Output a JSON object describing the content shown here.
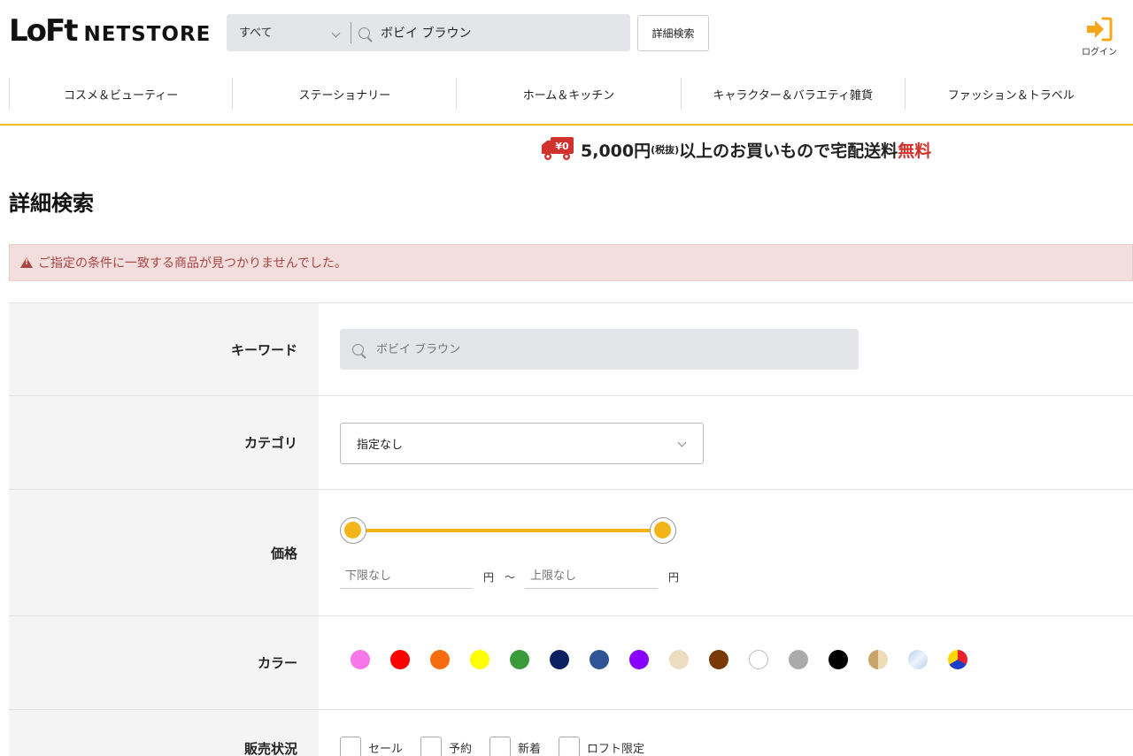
{
  "header": {
    "logo_mark": "LoFt",
    "logo_text": "NETSTORE",
    "search": {
      "scope": "すべて",
      "query": "ボビイ ブラウン"
    },
    "advanced_search_label": "詳細検索",
    "login_label": "ログイン"
  },
  "nav": {
    "items": [
      "コスメ＆ビューティー",
      "ステーショナリー",
      "ホーム＆キッチン",
      "キャラクター＆バラエティ雑貨",
      "ファッション＆トラベル"
    ]
  },
  "shipping_banner": {
    "badge": "¥0",
    "main": "5,000円",
    "paren": "(税抜)",
    "rest": "以上のお買いもので宅配送料",
    "free": "無料"
  },
  "page": {
    "title": "詳細検索",
    "alert": "ご指定の条件に一致する商品が見つかりませんでした。"
  },
  "form": {
    "keyword": {
      "label": "キーワード",
      "placeholder": "ボビイ ブラウン"
    },
    "category": {
      "label": "カテゴリ",
      "value": "指定なし"
    },
    "price": {
      "label": "価格",
      "min_placeholder": "下限なし",
      "max_placeholder": "上限なし",
      "unit": "円",
      "separator": "～",
      "range_fraction": [
        0,
        1
      ]
    },
    "color": {
      "label": "カラー",
      "swatches": [
        {
          "name": "pink",
          "color": "#f776e8"
        },
        {
          "name": "red",
          "color": "#ff0000"
        },
        {
          "name": "orange",
          "color": "#f86c10"
        },
        {
          "name": "yellow",
          "color": "#ffff00"
        },
        {
          "name": "green",
          "color": "#3a9b3a"
        },
        {
          "name": "navy",
          "color": "#0a2060"
        },
        {
          "name": "blue",
          "color": "#2f5597"
        },
        {
          "name": "purple",
          "color": "#8800ff"
        },
        {
          "name": "beige",
          "color": "#ecdcc0"
        },
        {
          "name": "brown",
          "color": "#7a3a08"
        },
        {
          "name": "white",
          "color": "#ffffff"
        },
        {
          "name": "gray",
          "color": "#aaaaaa"
        },
        {
          "name": "black",
          "color": "#000000"
        },
        {
          "name": "gold",
          "color": "#c8a46a"
        },
        {
          "name": "silver",
          "color": "#b6cdf0"
        },
        {
          "name": "multi",
          "color": "#e8202a"
        }
      ]
    },
    "status": {
      "label": "販売状況",
      "options": [
        "セール",
        "予約",
        "新着",
        "ロフト限定"
      ]
    }
  }
}
